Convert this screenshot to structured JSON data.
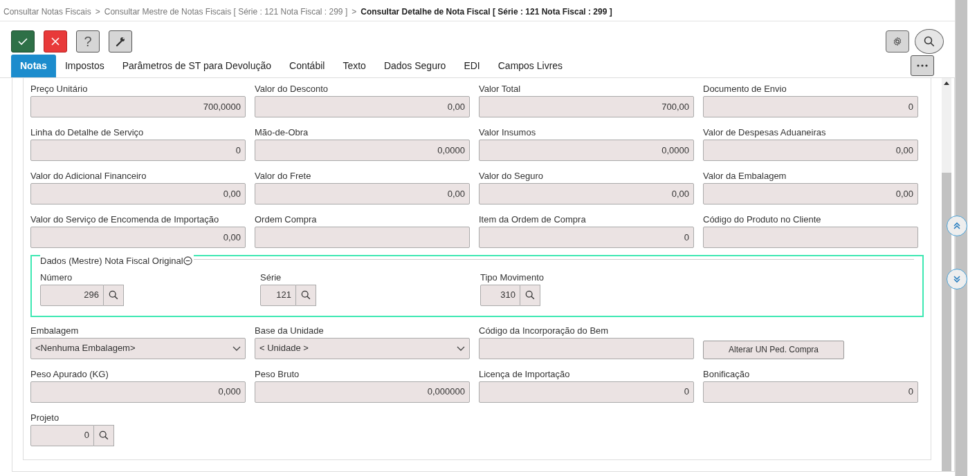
{
  "breadcrumb": [
    {
      "label": "Consultar Notas Fiscais",
      "current": false
    },
    {
      "label": "Consultar Mestre de Notas Fiscais [ Série : 121 Nota Fiscal : 299 ]",
      "current": false
    },
    {
      "label": "Consultar Detalhe de Nota Fiscal [ Série : 121 Nota Fiscal : 299 ]",
      "current": true
    }
  ],
  "breadcrumb_separator": ">",
  "toolbar": [
    {
      "kind": "confirm"
    },
    {
      "kind": "cancel"
    },
    {
      "kind": "help",
      "label": "?"
    },
    {
      "kind": "tools"
    }
  ],
  "tabs": [
    {
      "label": "Notas",
      "selected": true
    },
    {
      "label": "Impostos",
      "selected": false
    },
    {
      "label": "Parâmetros de ST para Devolução",
      "selected": false
    },
    {
      "label": "Contábil",
      "selected": false
    },
    {
      "label": "Texto",
      "selected": false
    },
    {
      "label": "Dados Seguro",
      "selected": false
    },
    {
      "label": "EDI",
      "selected": false
    },
    {
      "label": "Campos Livres",
      "selected": false
    }
  ],
  "sections": [
    {
      "kind": "grid",
      "fields": [
        {
          "kind": "input",
          "label": "Preço Unitário",
          "value": "700,0000"
        },
        {
          "kind": "input",
          "label": "Valor do Desconto",
          "value": "0,00"
        },
        {
          "kind": "input",
          "label": "Valor Total",
          "value": "700,00"
        },
        {
          "kind": "input",
          "label": "Documento de Envio",
          "value": "0"
        },
        {
          "kind": "input",
          "label": "Linha do Detalhe de Serviço",
          "value": "0"
        },
        {
          "kind": "input",
          "label": "Mão-de-Obra",
          "value": "0,0000"
        },
        {
          "kind": "input",
          "label": "Valor Insumos",
          "value": "0,0000"
        },
        {
          "kind": "input",
          "label": "Valor de Despesas Aduaneiras",
          "value": "0,00"
        },
        {
          "kind": "input",
          "label": "Valor do Adicional Financeiro",
          "value": "0,00"
        },
        {
          "kind": "input",
          "label": "Valor do Frete",
          "value": "0,00"
        },
        {
          "kind": "input",
          "label": "Valor do Seguro",
          "value": "0,00"
        },
        {
          "kind": "input",
          "label": "Valor da Embalagem",
          "value": "0,00"
        },
        {
          "kind": "input",
          "label": "Valor do Serviço de Encomenda de Importação",
          "value": "0,00"
        },
        {
          "kind": "input",
          "label": "Ordem Compra"
        },
        {
          "kind": "input",
          "label": "Item da Ordem de Compra",
          "value": "0"
        },
        {
          "kind": "input",
          "label": "Código do Produto no Cliente"
        }
      ]
    },
    {
      "kind": "group",
      "legend": "Dados (Mestre) Nota Fiscal Original",
      "expanded": true,
      "fields": [
        {
          "kind": "lookup",
          "label": "Número",
          "value": "296"
        },
        {
          "kind": "lookup",
          "label": "Série",
          "value": "121"
        },
        {
          "kind": "lookup",
          "label": "Tipo Movimento",
          "value": "310"
        }
      ]
    },
    {
      "kind": "grid",
      "fields": [
        {
          "kind": "select",
          "label": "Embalagem",
          "value": "<Nenhuma Embalagem>"
        },
        {
          "kind": "select",
          "label": "Base da Unidade",
          "value": "< Unidade >"
        },
        {
          "kind": "input",
          "label": "Código da Incorporação do Bem"
        },
        {
          "kind": "button",
          "value": "Alterar UN Ped. Compra"
        },
        {
          "kind": "input",
          "label": "Peso Apurado (KG)",
          "value": "0,000"
        },
        {
          "kind": "input",
          "label": "Peso Bruto",
          "value": "0,000000"
        },
        {
          "kind": "input",
          "label": "Licença de Importação",
          "value": "0"
        },
        {
          "kind": "input",
          "label": "Bonificação",
          "value": "0"
        },
        {
          "kind": "lookup",
          "label": "Projeto",
          "value": "0"
        }
      ]
    }
  ]
}
